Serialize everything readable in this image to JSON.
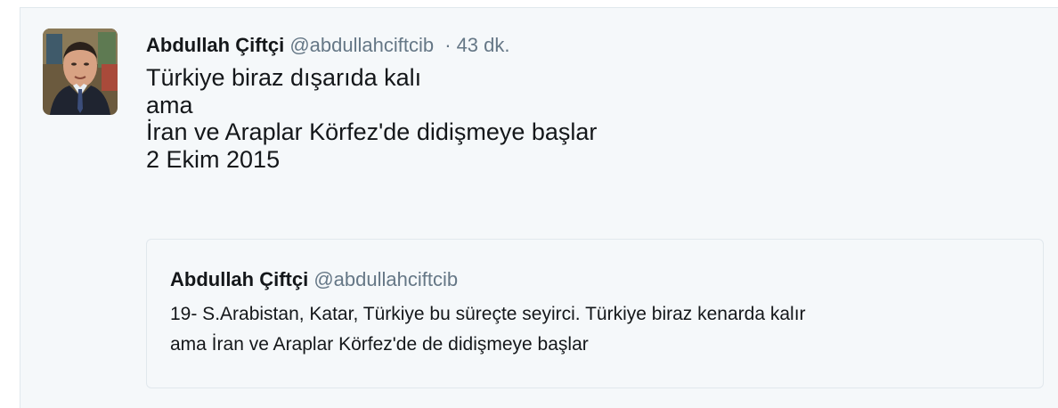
{
  "tweet": {
    "author_name": "Abdullah Çiftçi",
    "author_handle": "@abdullahciftcib",
    "separator": "·",
    "timestamp": "43 dk.",
    "text_lines": [
      "Türkiye biraz dışarıda kalı",
      "ama",
      "İran ve Araplar Körfez'de didişmeye başlar",
      "2 Ekim 2015"
    ],
    "avatar_icon": "profile-photo-man-in-suit"
  },
  "quoted_tweet": {
    "author_name": "Abdullah Çiftçi",
    "author_handle": "@abdullahciftcib",
    "text_lines": [
      "19- S.Arabistan, Katar, Türkiye bu süreçte seyirci. Türkiye biraz kenarda kalır",
      "ama İran ve Araplar Körfez'de de didişmeye başlar"
    ]
  },
  "colors": {
    "background": "#f5f8fa",
    "name": "#14171a",
    "secondary": "#657786",
    "border": "#e1e8ed"
  }
}
